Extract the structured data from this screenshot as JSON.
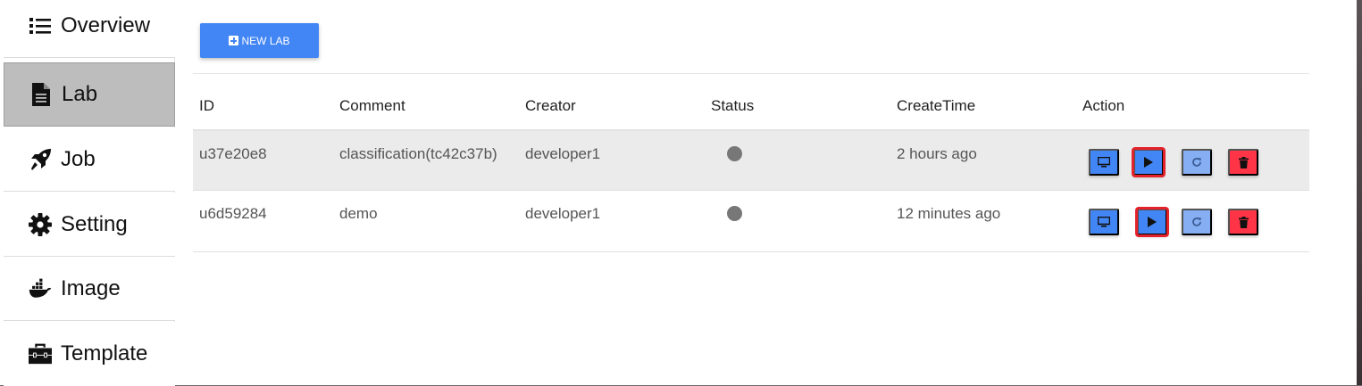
{
  "sidebar": {
    "items": [
      {
        "label": "Overview",
        "icon": "list-icon",
        "active": false
      },
      {
        "label": "Lab",
        "icon": "document-icon",
        "active": true
      },
      {
        "label": "Job",
        "icon": "rocket-icon",
        "active": false
      },
      {
        "label": "Setting",
        "icon": "gear-icon",
        "active": false
      },
      {
        "label": "Image",
        "icon": "docker-whale-icon",
        "active": false
      },
      {
        "label": "Template",
        "icon": "toolbox-icon",
        "active": false
      }
    ]
  },
  "toolbar": {
    "new_lab_label": "NEW LAB"
  },
  "table": {
    "columns": [
      "ID",
      "Comment",
      "Creator",
      "Status",
      "CreateTime",
      "Action"
    ],
    "rows": [
      {
        "id": "u37e20e8",
        "comment": "classification(tc42c37b)",
        "creator": "developer1",
        "status": "stopped",
        "create_time": "2 hours ago"
      },
      {
        "id": "u6d59284",
        "comment": "demo",
        "creator": "developer1",
        "status": "stopped",
        "create_time": "12 minutes ago"
      }
    ],
    "actions": [
      "open-desktop-icon",
      "play-icon",
      "restart-icon",
      "trash-icon"
    ]
  },
  "colors": {
    "primary": "#4285f4",
    "primary_light": "#86aef3",
    "danger": "#ff3547",
    "highlight_outline": "#e3222b",
    "status_stopped": "#777777",
    "active_nav": "#bdbdbd"
  }
}
